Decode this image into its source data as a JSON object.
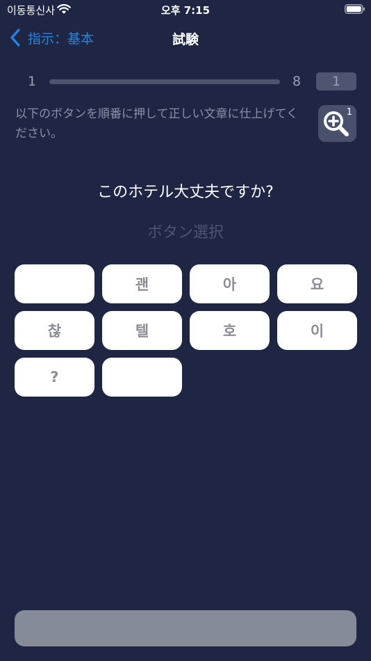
{
  "status_bar": {
    "carrier": "이동통신사",
    "time": "오후 7:15"
  },
  "nav": {
    "back_label": "指示：基本",
    "title": "試験"
  },
  "progress": {
    "start": "1",
    "end": "8",
    "current": "1",
    "fraction": 0
  },
  "instruction": "以下のボタンを順番に押して正しい文章に仕上げてください。",
  "hint": {
    "count": "1"
  },
  "question": "このホテル大丈夫ですか?",
  "answer_placeholder": "ボタン選択",
  "word_buttons": [
    "",
    "괜",
    "아",
    "요",
    "찮",
    "텔",
    "호",
    "이",
    "?",
    ""
  ],
  "submit_label": "",
  "colors": {
    "background": "#1f2644",
    "accent": "#1e88f0",
    "button_bg": "#ffffff",
    "button_text": "#8d8d95",
    "disabled_submit": "#868b9a"
  }
}
